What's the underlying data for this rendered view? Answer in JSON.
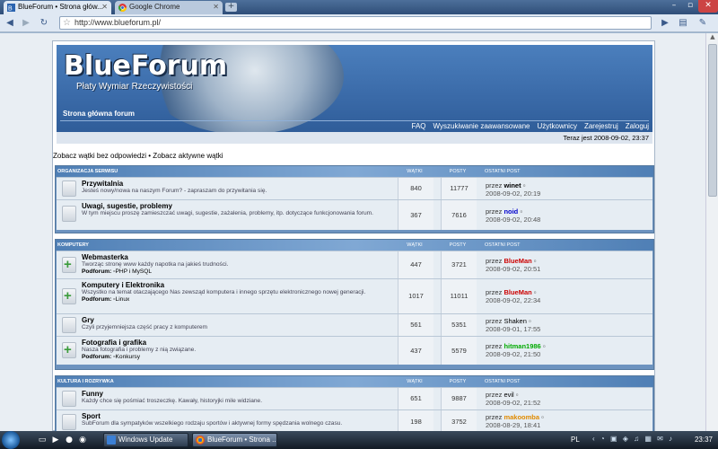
{
  "browser": {
    "tabs": [
      {
        "title": "BlueForum • Strona głów...",
        "active": true
      },
      {
        "title": "Google Chrome",
        "active": false
      }
    ],
    "url": "http://www.blueforum.pl/",
    "icons": {
      "back": "back-arrow-icon",
      "forward": "forward-arrow-icon",
      "reload": "reload-icon",
      "star": "star-icon",
      "page": "page-menu-icon",
      "tools": "wrench-icon"
    }
  },
  "forum": {
    "logo": "BlueForum",
    "tagline": "Płaty Wymiar Rzeczywistości",
    "breadcrumb": "Strona główna forum",
    "nav": [
      "FAQ",
      "Wyszukiwanie zaawansowane",
      "Użytkownicy",
      "Zarejestruj",
      "Zaloguj"
    ],
    "time": "Teraz jest 2008-09-02, 23:37",
    "quicklinks": "Zobacz wątki bez odpowiedzi • Zobacz aktywne wątki",
    "columns": {
      "topics": "WĄTKI",
      "posts": "POSTY",
      "last": "OSTATNI POST"
    },
    "categories": [
      {
        "name": "ORGANIZACJA SERWISU",
        "forums": [
          {
            "name": "Przywitalnia",
            "desc": "Jesteś nowy/nowa na naszym Forum? - zapraszam do przywitania się.",
            "sub_label": "",
            "sub": "",
            "topics": "840",
            "posts": "11777",
            "by": "przez",
            "user": "winet",
            "user_color": "#000000",
            "date": "2008-09-02, 20:19",
            "has_new": false
          },
          {
            "name": "Uwagi, sugestie, problemy",
            "desc": "W tym miejscu proszę zamieszczać uwagi, sugestie, zażalenia, problemy, itp. dotyczące funkcjonowania forum.",
            "sub_label": "",
            "sub": "",
            "topics": "367",
            "posts": "7616",
            "by": "przez",
            "user": "noid",
            "user_color": "#0000cc",
            "date": "2008-09-02, 20:48",
            "has_new": false
          }
        ]
      },
      {
        "name": "KOMPUTERY",
        "forums": [
          {
            "name": "Webmasterka",
            "desc": "Tworząc stronę www każdy napotka na jakieś trudności.",
            "sub_label": "Podforum:",
            "sub": "PHP i MySQL",
            "topics": "447",
            "posts": "3721",
            "by": "przez",
            "user": "BlueMan",
            "user_color": "#cc0000",
            "date": "2008-09-02, 20:51",
            "has_new": true
          },
          {
            "name": "Komputery i Elektronika",
            "desc": "Wszystko na temat otaczającego Nas zewsząd komputera i innego sprzętu elektronicznego nowej generacji.",
            "sub_label": "Podforum:",
            "sub": "Linux",
            "topics": "1017",
            "posts": "11011",
            "by": "przez",
            "user": "BlueMan",
            "user_color": "#cc0000",
            "date": "2008-09-02, 22:34",
            "has_new": true
          },
          {
            "name": "Gry",
            "desc": "Czyli przyjemniejsza część pracy z komputerem",
            "sub_label": "",
            "sub": "",
            "topics": "561",
            "posts": "5351",
            "by": "przez",
            "user": "Shaken",
            "user_color": "#000000",
            "date": "2008-09-01, 17:55",
            "has_new": false
          },
          {
            "name": "Fotografia i grafika",
            "desc": "Nasza fotografia i problemy z nią związane.",
            "sub_label": "Podforum:",
            "sub": "Konkursy",
            "topics": "437",
            "posts": "5579",
            "by": "przez",
            "user": "hitman1986",
            "user_color": "#00aa00",
            "date": "2008-09-02, 21:50",
            "has_new": true
          }
        ]
      },
      {
        "name": "KULTURA I ROZRYWKA",
        "forums": [
          {
            "name": "Funny",
            "desc": "Każdy chce się pośmiać troszeczkę. Kawały, historyjki mile widziane.",
            "sub_label": "",
            "sub": "",
            "topics": "651",
            "posts": "9887",
            "by": "przez",
            "user": "evil",
            "user_color": "#000000",
            "date": "2008-09-02, 21:52",
            "has_new": false
          },
          {
            "name": "Sport",
            "desc": "SubForum dla sympatyków wszelkiego rodzaju sportów i aktywnej formy spędzania wolnego czasu.",
            "sub_label": "",
            "sub": "",
            "topics": "198",
            "posts": "3752",
            "by": "przez",
            "user": "makoomba",
            "user_color": "#e08a00",
            "date": "2008-08-29, 18:41",
            "has_new": false
          }
        ]
      }
    ]
  },
  "taskbar": {
    "tasks": [
      "Windows Update",
      "BlueForum • Strona ..."
    ],
    "lang": "PL",
    "clock": "23:37"
  }
}
